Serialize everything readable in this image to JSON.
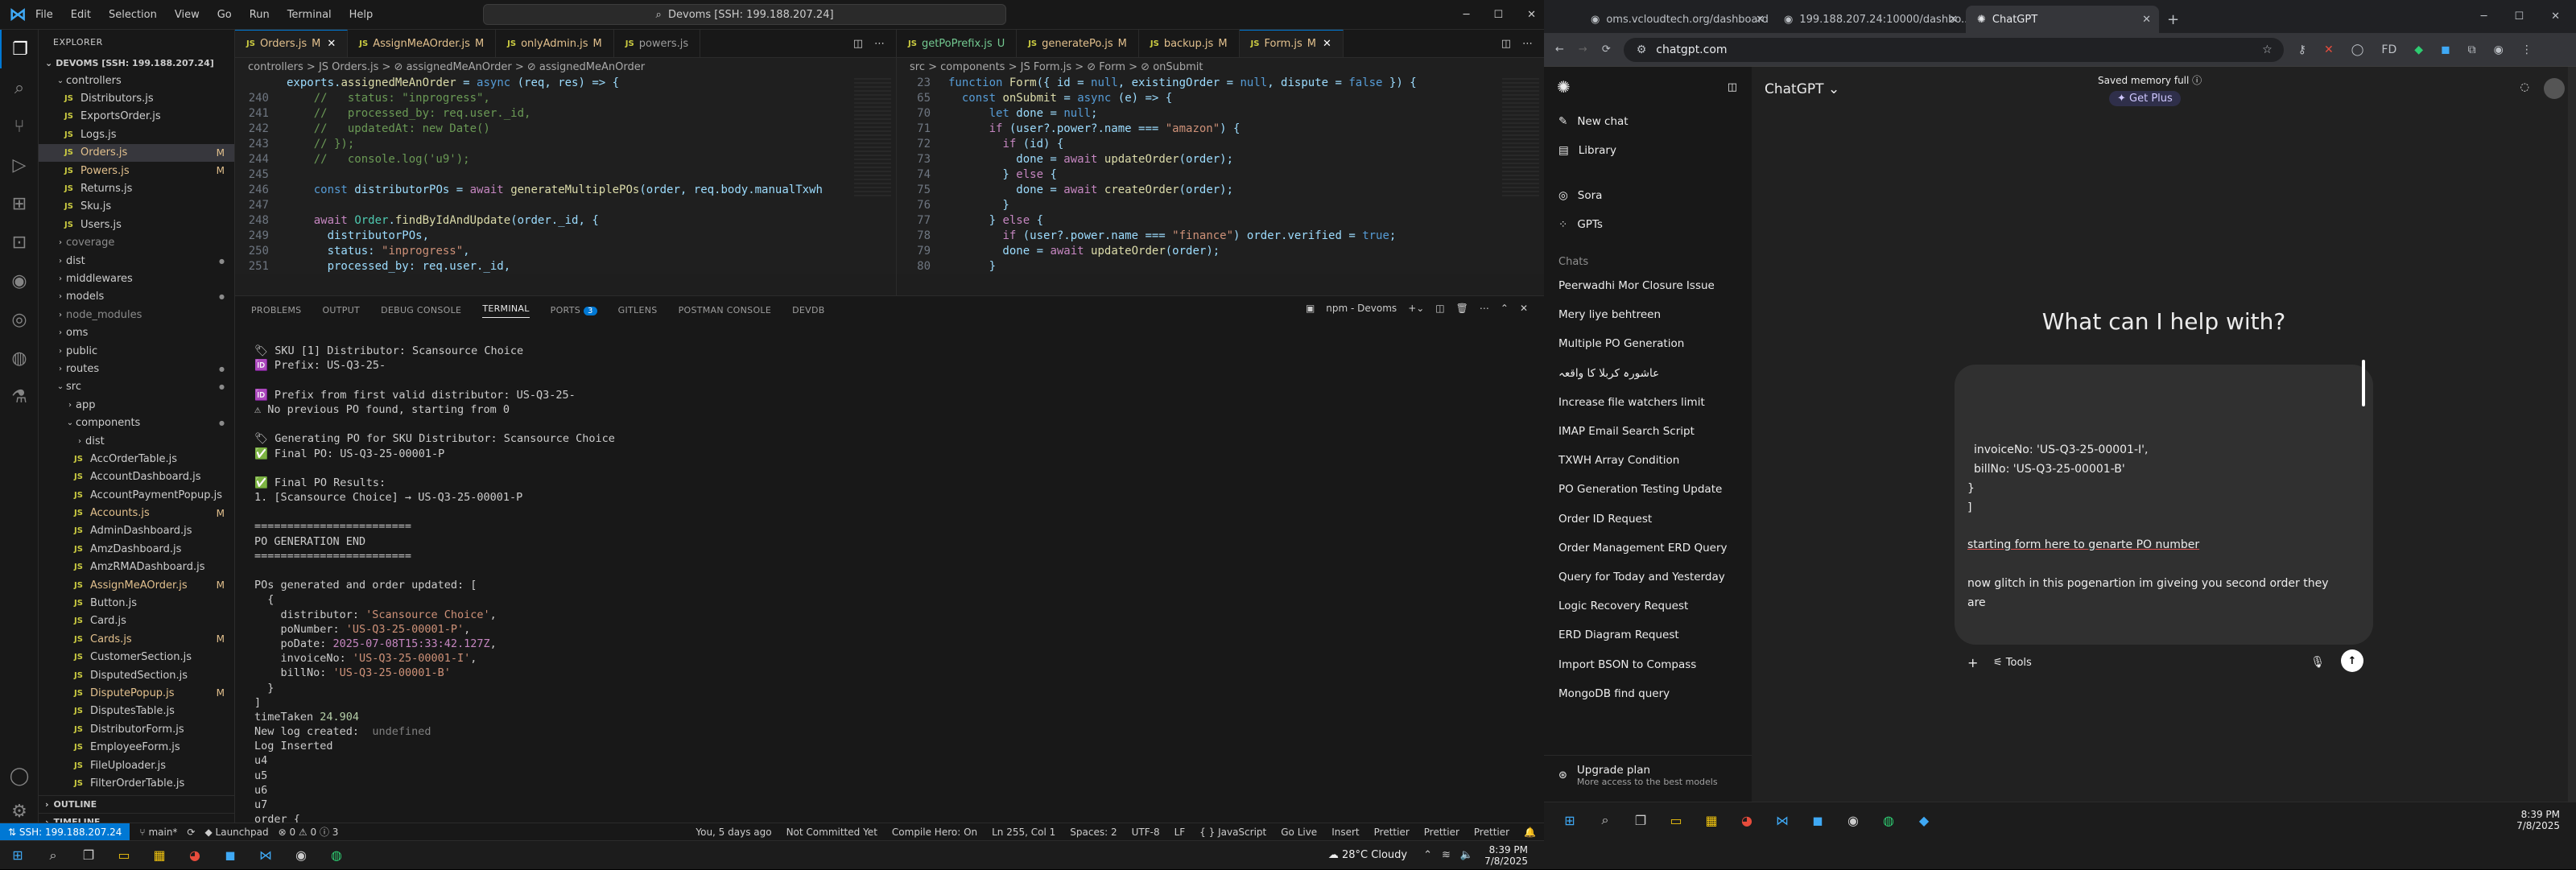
{
  "vscode": {
    "menu": [
      "File",
      "Edit",
      "Selection",
      "View",
      "Go",
      "Run",
      "Terminal",
      "Help"
    ],
    "search_box": "Devoms [SSH: 199.188.207.24]",
    "explorer": {
      "header": "EXPLORER",
      "root": "DEVOMS [SSH: 199.188.207.24]",
      "items": [
        {
          "label": "controllers",
          "type": "folder-open",
          "indent": 1
        },
        {
          "label": "Distributors.js",
          "type": "js",
          "indent": 2
        },
        {
          "label": "ExportsOrder.js",
          "type": "js",
          "indent": 2
        },
        {
          "label": "Logs.js",
          "type": "js",
          "indent": 2
        },
        {
          "label": "Orders.js",
          "type": "js",
          "indent": 2,
          "mark": "M",
          "selected": true
        },
        {
          "label": "Powers.js",
          "type": "js",
          "indent": 2,
          "mark": "M"
        },
        {
          "label": "Returns.js",
          "type": "js",
          "indent": 2
        },
        {
          "label": "Sku.js",
          "type": "js",
          "indent": 2
        },
        {
          "label": "Users.js",
          "type": "js",
          "indent": 2
        },
        {
          "label": "coverage",
          "type": "folder",
          "indent": 1,
          "dim": true
        },
        {
          "label": "dist",
          "type": "folder",
          "indent": 1,
          "dot": true
        },
        {
          "label": "middlewares",
          "type": "folder",
          "indent": 1
        },
        {
          "label": "models",
          "type": "folder",
          "indent": 1,
          "dot": true
        },
        {
          "label": "node_modules",
          "type": "folder",
          "indent": 1,
          "dim": true
        },
        {
          "label": "oms",
          "type": "folder",
          "indent": 1
        },
        {
          "label": "public",
          "type": "folder",
          "indent": 1
        },
        {
          "label": "routes",
          "type": "folder",
          "indent": 1,
          "dot": true
        },
        {
          "label": "src",
          "type": "folder-open",
          "indent": 1,
          "dot": true
        },
        {
          "label": "app",
          "type": "folder",
          "indent": 2
        },
        {
          "label": "components",
          "type": "folder-open",
          "indent": 2,
          "dot": true
        },
        {
          "label": "dist",
          "type": "folder",
          "indent": 3
        },
        {
          "label": "AccOrderTable.js",
          "type": "js",
          "indent": 3
        },
        {
          "label": "AccountDashboard.js",
          "type": "js",
          "indent": 3
        },
        {
          "label": "AccountPaymentPopup.js",
          "type": "js",
          "indent": 3
        },
        {
          "label": "Accounts.js",
          "type": "js",
          "indent": 3,
          "mark": "M"
        },
        {
          "label": "AdminDashboard.js",
          "type": "js",
          "indent": 3
        },
        {
          "label": "AmzDashboard.js",
          "type": "js",
          "indent": 3
        },
        {
          "label": "AmzRMADashboard.js",
          "type": "js",
          "indent": 3
        },
        {
          "label": "AssignMeAOrder.js",
          "type": "js",
          "indent": 3,
          "mark": "M"
        },
        {
          "label": "Button.js",
          "type": "js",
          "indent": 3
        },
        {
          "label": "Card.js",
          "type": "js",
          "indent": 3
        },
        {
          "label": "Cards.js",
          "type": "js",
          "indent": 3,
          "mark": "M"
        },
        {
          "label": "CustomerSection.js",
          "type": "js",
          "indent": 3
        },
        {
          "label": "DisputedSection.js",
          "type": "js",
          "indent": 3
        },
        {
          "label": "DisputePopup.js",
          "type": "js",
          "indent": 3,
          "mark": "M"
        },
        {
          "label": "DisputesTable.js",
          "type": "js",
          "indent": 3
        },
        {
          "label": "DistributorForm.js",
          "type": "js",
          "indent": 3
        },
        {
          "label": "EmployeeForm.js",
          "type": "js",
          "indent": 3
        },
        {
          "label": "FileUploader.js",
          "type": "js",
          "indent": 3
        },
        {
          "label": "FilterOrderTable.js",
          "type": "js",
          "indent": 3
        }
      ],
      "outline": "OUTLINE",
      "timeline": "TIMELINE"
    },
    "left_tabs": [
      {
        "label": "Orders.js",
        "mark": "M",
        "active": true
      },
      {
        "label": "AssignMeAOrder.js",
        "mark": "M"
      },
      {
        "label": "onlyAdmin.js",
        "mark": "M"
      },
      {
        "label": "powers.js",
        "mark": ""
      }
    ],
    "right_tabs": [
      {
        "label": "getPoPrefix.js",
        "mark": "U"
      },
      {
        "label": "generatePo.js",
        "mark": "M"
      },
      {
        "label": "backup.js",
        "mark": "M"
      },
      {
        "label": "Form.js",
        "mark": "M",
        "active": true
      }
    ],
    "left_crumbs": "controllers > JS Orders.js > ⊘ assignedMeAnOrder > ⊘ assignedMeAnOrder",
    "right_crumbs": "src > components > JS Form.js > ⊘ Form > ⊘ onSubmit",
    "left_code": [
      {
        "n": "",
        "t": "exports.assignedMeAnOrder = async (req, res) => {"
      },
      {
        "n": "240",
        "t": "    //   status: \"inprogress\","
      },
      {
        "n": "241",
        "t": "    //   processed_by: req.user._id,"
      },
      {
        "n": "242",
        "t": "    //   updatedAt: new Date()"
      },
      {
        "n": "243",
        "t": "    // });"
      },
      {
        "n": "244",
        "t": "    //   console.log('u9');"
      },
      {
        "n": "245",
        "t": ""
      },
      {
        "n": "246",
        "t": "    const distributorPOs = await generateMultiplePOs(order, req.body.manualTxwh"
      },
      {
        "n": "247",
        "t": ""
      },
      {
        "n": "248",
        "t": "    await Order.findByIdAndUpdate(order._id, {"
      },
      {
        "n": "249",
        "t": "      distributorPOs,"
      },
      {
        "n": "250",
        "t": "      status: \"inprogress\","
      },
      {
        "n": "251",
        "t": "      processed_by: req.user._id,"
      }
    ],
    "right_code": [
      {
        "n": "23",
        "t": "function Form({ id = null, existingOrder = null, dispute = false }) {"
      },
      {
        "n": "65",
        "t": "  const onSubmit = async (e) => {"
      },
      {
        "n": "70",
        "t": "      let done = null;"
      },
      {
        "n": "71",
        "t": "      if (user?.power?.name === \"amazon\") {"
      },
      {
        "n": "72",
        "t": "        if (id) {"
      },
      {
        "n": "73",
        "t": "          done = await updateOrder(order);"
      },
      {
        "n": "74",
        "t": "        } else {"
      },
      {
        "n": "75",
        "t": "          done = await createOrder(order);"
      },
      {
        "n": "76",
        "t": "        }"
      },
      {
        "n": "77",
        "t": "      } else {"
      },
      {
        "n": "78",
        "t": "        if (user?.power.name === \"finance\") order.verified = true;"
      },
      {
        "n": "79",
        "t": "        done = await updateOrder(order);"
      },
      {
        "n": "80",
        "t": "      }"
      }
    ],
    "panel_tabs": [
      "PROBLEMS",
      "OUTPUT",
      "DEBUG CONSOLE",
      "TERMINAL",
      "PORTS",
      "GITLENS",
      "POSTMAN CONSOLE",
      "DEVDB"
    ],
    "ports_badge": "3",
    "terminal_name": "npm - Devoms",
    "terminal_lines": [
      "",
      "🏷 SKU [1] Distributor: Scansource Choice",
      "🆔 Prefix: US-Q3-25-",
      "",
      "🆔 Prefix from first valid distributor: US-Q3-25-",
      "⚠ No previous PO found, starting from 0",
      "",
      "🏷 Generating PO for SKU Distributor: Scansource Choice",
      "✅ Final PO: US-Q3-25-00001-P",
      "",
      "✅ Final PO Results:",
      "1. [Scansource Choice] → US-Q3-25-00001-P",
      "",
      "========================",
      "PO GENERATION END",
      "========================",
      "",
      "POs generated and order updated: [",
      "  {",
      "    distributor: 'Scansource Choice',",
      "    poNumber: 'US-Q3-25-00001-P',",
      "    poDate: 2025-07-08T15:33:42.127Z,",
      "    invoiceNo: 'US-Q3-25-00001-I',",
      "    billNo: 'US-Q3-25-00001-B'",
      "  }",
      "]",
      "timeTaken 24.904",
      "New log created:  undefined",
      "Log Inserted",
      "u4",
      "u5",
      "u6",
      "u7",
      "order {"
    ],
    "status": {
      "remote": "SSH: 199.188.207.24",
      "branch": "main*",
      "launchpad": "Launchpad",
      "problems": "0",
      "warnings": "0",
      "info": "3",
      "blame": "You, 5 days ago",
      "commit": "Not Committed Yet",
      "compile": "Compile Hero: On",
      "position": "Ln 255, Col 1",
      "spaces": "Spaces: 2",
      "encoding": "UTF-8",
      "eol": "LF",
      "lang": "{ } JavaScript",
      "golive": "Go Live",
      "insert": "Insert",
      "prettier": "Prettier",
      "prettier2": "Prettier",
      "prettier3": "Prettier"
    },
    "taskbar": {
      "weather": "28°C Cloudy",
      "time": "8:39 PM",
      "date": "7/8/2025"
    }
  },
  "chrome": {
    "tabs": [
      {
        "label": "oms.vcloudtech.org/dashboard"
      },
      {
        "label": "199.188.207.24:10000/dashbo..."
      },
      {
        "label": "ChatGPT",
        "active": true
      }
    ],
    "url": "chatgpt.com",
    "gpt": {
      "nav": [
        "New chat",
        "Library",
        "Sora",
        "GPTs"
      ],
      "chats_header": "Chats",
      "chats": [
        "Peerwadhi Mor Closure Issue",
        "Mery liye behtreen",
        "Multiple PO Generation",
        "عاشورہ کربلا کا واقعہ",
        "Increase file watchers limit",
        "IMAP Email Search Script",
        "TXWH Array Condition",
        "PO Generation Testing Update",
        "Order ID Request",
        "Order Management ERD Query",
        "Query for Today and Yesterday",
        "Logic Recovery Request",
        "ERD Diagram Request",
        "Import BSON to Compass",
        "MongoDB find query"
      ],
      "upgrade_title": "Upgrade plan",
      "upgrade_sub": "More access to the best models",
      "model": "ChatGPT",
      "saved_memory": "Saved memory full",
      "get_plus": "Get Plus",
      "heading": "What can I help with?",
      "prompt_code": [
        "invoiceNo: 'US-Q3-25-00001-I',",
        "billNo: 'US-Q3-25-00001-B'",
        "}",
        "]"
      ],
      "prompt_line1": "starting form here to genarte PO number",
      "prompt_line2": "now glitch in this pogenartion  im giveing you second order they",
      "prompt_line3": "are",
      "tools": "Tools"
    },
    "taskbar_time": "8:39 PM",
    "taskbar_date": "7/8/2025"
  },
  "colors": {
    "accent": "#0078d4",
    "modified": "#e2c08d",
    "untracked": "#73c991"
  }
}
